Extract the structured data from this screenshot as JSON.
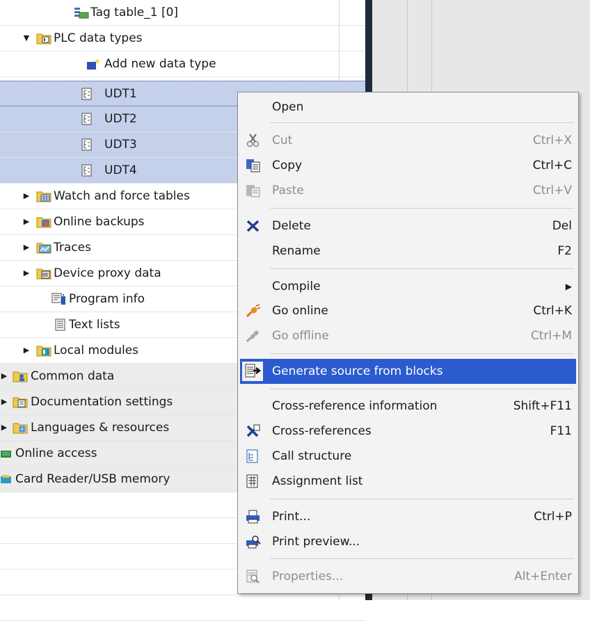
{
  "tree": {
    "items": [
      {
        "label": "Tag table_1 [0]",
        "icon": "tag-table-icon"
      },
      {
        "label": "PLC data types",
        "icon": "plc-data-types-folder-icon",
        "expanded": true
      },
      {
        "label": "Add new data type",
        "icon": "add-new-data-type-icon"
      },
      {
        "label": "UDT1",
        "icon": "udt-icon",
        "selected": true
      },
      {
        "label": "UDT2",
        "icon": "udt-icon",
        "selected": true
      },
      {
        "label": "UDT3",
        "icon": "udt-icon",
        "selected": true
      },
      {
        "label": "UDT4",
        "icon": "udt-icon",
        "selected": true
      },
      {
        "label": "Watch and force tables",
        "icon": "watch-force-folder-icon"
      },
      {
        "label": "Online backups",
        "icon": "online-backups-folder-icon"
      },
      {
        "label": "Traces",
        "icon": "traces-folder-icon"
      },
      {
        "label": "Device proxy data",
        "icon": "device-proxy-folder-icon"
      },
      {
        "label": "Program info",
        "icon": "program-info-icon"
      },
      {
        "label": "Text lists",
        "icon": "text-lists-icon"
      },
      {
        "label": "Local modules",
        "icon": "local-modules-folder-icon"
      },
      {
        "label": "Common data",
        "icon": "common-data-folder-icon"
      },
      {
        "label": "Documentation settings",
        "icon": "documentation-settings-folder-icon"
      },
      {
        "label": "Languages & resources",
        "icon": "languages-resources-folder-icon"
      },
      {
        "label": "Online access",
        "icon": "online-access-icon"
      },
      {
        "label": "Card Reader/USB memory",
        "icon": "card-reader-icon"
      }
    ]
  },
  "context_menu": {
    "items": [
      {
        "label": "Open",
        "shortcut": "",
        "icon": "",
        "disabled": false
      },
      {
        "label": "Cut",
        "shortcut": "Ctrl+X",
        "icon": "cut-icon",
        "disabled": true
      },
      {
        "label": "Copy",
        "shortcut": "Ctrl+C",
        "icon": "copy-icon",
        "disabled": false
      },
      {
        "label": "Paste",
        "shortcut": "Ctrl+V",
        "icon": "paste-icon",
        "disabled": true
      },
      {
        "label": "Delete",
        "shortcut": "Del",
        "icon": "delete-icon",
        "disabled": false
      },
      {
        "label": "Rename",
        "shortcut": "F2",
        "icon": "",
        "disabled": false
      },
      {
        "label": "Compile",
        "shortcut": "",
        "icon": "",
        "disabled": false,
        "submenu": true
      },
      {
        "label": "Go online",
        "shortcut": "Ctrl+K",
        "icon": "go-online-icon",
        "disabled": false
      },
      {
        "label": "Go offline",
        "shortcut": "Ctrl+M",
        "icon": "go-offline-icon",
        "disabled": true
      },
      {
        "label": "Generate source from blocks",
        "shortcut": "",
        "icon": "generate-source-icon",
        "disabled": false,
        "highlighted": true
      },
      {
        "label": "Cross-reference information",
        "shortcut": "Shift+F11",
        "icon": "",
        "disabled": false
      },
      {
        "label": "Cross-references",
        "shortcut": "F11",
        "icon": "cross-references-icon",
        "disabled": false
      },
      {
        "label": "Call structure",
        "shortcut": "",
        "icon": "call-structure-icon",
        "disabled": false
      },
      {
        "label": "Assignment list",
        "shortcut": "",
        "icon": "assignment-list-icon",
        "disabled": false
      },
      {
        "label": "Print...",
        "shortcut": "Ctrl+P",
        "icon": "print-icon",
        "disabled": false
      },
      {
        "label": "Print preview...",
        "shortcut": "",
        "icon": "print-preview-icon",
        "disabled": false
      },
      {
        "label": "Properties...",
        "shortcut": "Alt+Enter",
        "icon": "properties-icon",
        "disabled": true
      }
    ],
    "submenu_arrow": "▶"
  },
  "colors": {
    "selection": "#c5d0ea",
    "highlight": "#2b5bcf",
    "menu_background": "#f3f3f3",
    "disabled_text": "#8d8d8d"
  }
}
